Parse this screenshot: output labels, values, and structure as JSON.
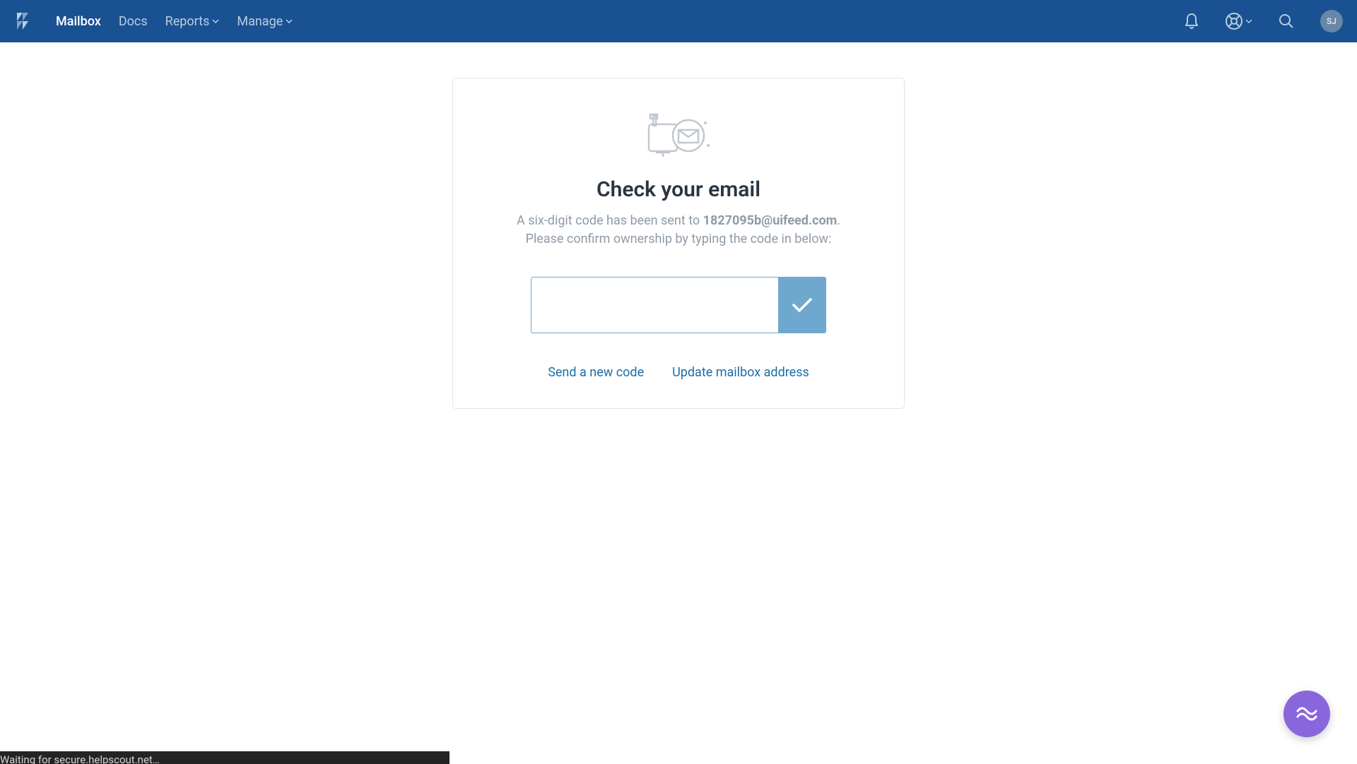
{
  "nav": {
    "items": [
      "Mailbox",
      "Docs",
      "Reports",
      "Manage"
    ],
    "avatar_initials": "SJ"
  },
  "card": {
    "title": "Check your email",
    "desc_pre": "A six-digit code has been sent to ",
    "desc_email": "1827095b@uifeed.com",
    "desc_post": ". Please confirm ownership by typing the code in below:",
    "code_value": "",
    "link_new_code": "Send a new code",
    "link_update_address": "Update mailbox address"
  },
  "status": "Waiting for secure.helpscout.net…"
}
